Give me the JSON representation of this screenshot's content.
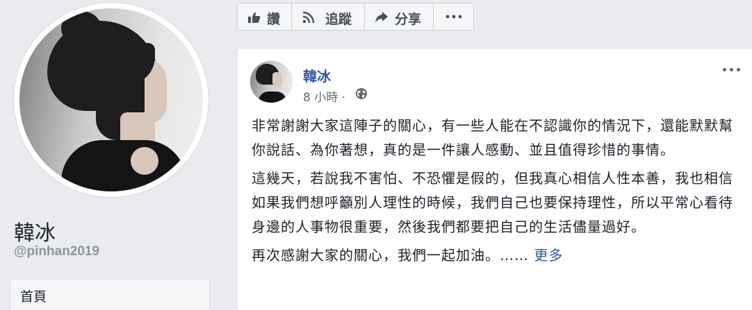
{
  "profile": {
    "name": "韓冰",
    "handle": "@pinhan2019",
    "nav_home": "首頁"
  },
  "actions": {
    "like_label": "讚",
    "follow_label": "追蹤",
    "share_label": "分享",
    "more_icon": "more-horizontal-icon"
  },
  "post": {
    "author": "韓冰",
    "time": "8 小時 ·",
    "audience_icon": "globe-icon",
    "paragraphs": [
      "非常謝謝大家這陣子的關心，有一些人能在不認識你的情況下，還能默默幫你說話、為你著想，真的是一件讓人感動、並且值得珍惜的事情。",
      "這幾天，若說我不害怕、不恐懼是假的，但我真心相信人性本善，我也相信如果我們想呼籲別人理性的時候，我們自己也要保持理性，所以平常心看待身邊的人事物很重要，然後我們都要把自己的生活儘量過好。",
      "再次感謝大家的關心，我們一起加油。……"
    ],
    "see_more": "更多"
  },
  "colors": {
    "page_bg": "#e9ebee",
    "link": "#365899",
    "muted": "#90949c"
  }
}
